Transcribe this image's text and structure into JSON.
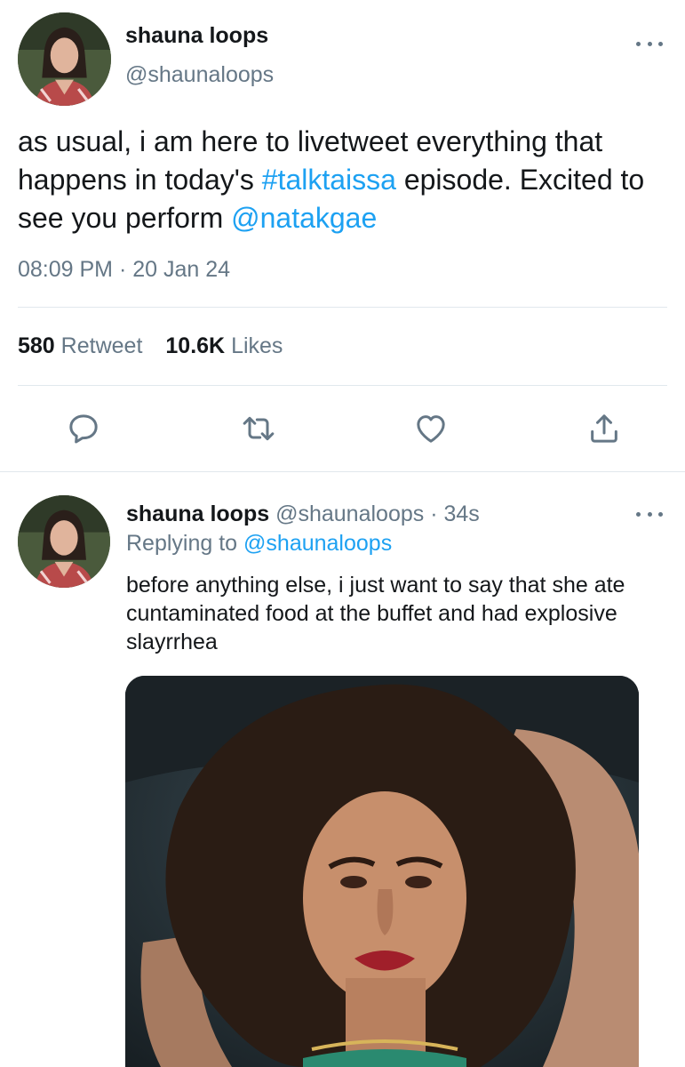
{
  "main_tweet": {
    "author_name": "shauna loops",
    "author_handle": "@shaunaloops",
    "text_part1": "as usual, i am here to livetweet everything that happens in today's ",
    "hashtag": "#talktaissa",
    "text_part2": " episode. Excited to see you perform ",
    "mention": "@natakgae",
    "timestamp": "08:09 PM · 20 Jan 24",
    "retweet_count": "580",
    "retweet_label": "Retweet",
    "likes_count": "10.6K",
    "likes_label": "Likes",
    "actions": [
      {
        "name": "reply",
        "icon": "comment-icon"
      },
      {
        "name": "retweet",
        "icon": "retweet-icon"
      },
      {
        "name": "like",
        "icon": "heart-icon"
      },
      {
        "name": "share",
        "icon": "share-icon"
      }
    ]
  },
  "reply_tweet": {
    "author_name": "shauna loops",
    "author_handle": "@shaunaloops",
    "time_ago": "34s",
    "replying_label": "Replying to",
    "replying_to": "@shaunaloops",
    "text": "before anything else, i just want to say that she ate cuntaminated food at the buffet and had explosive slayrrhea"
  },
  "colors": {
    "link": "#1da1f2",
    "muted": "#657786",
    "text": "#14171a",
    "divider": "#e1e8ed"
  }
}
